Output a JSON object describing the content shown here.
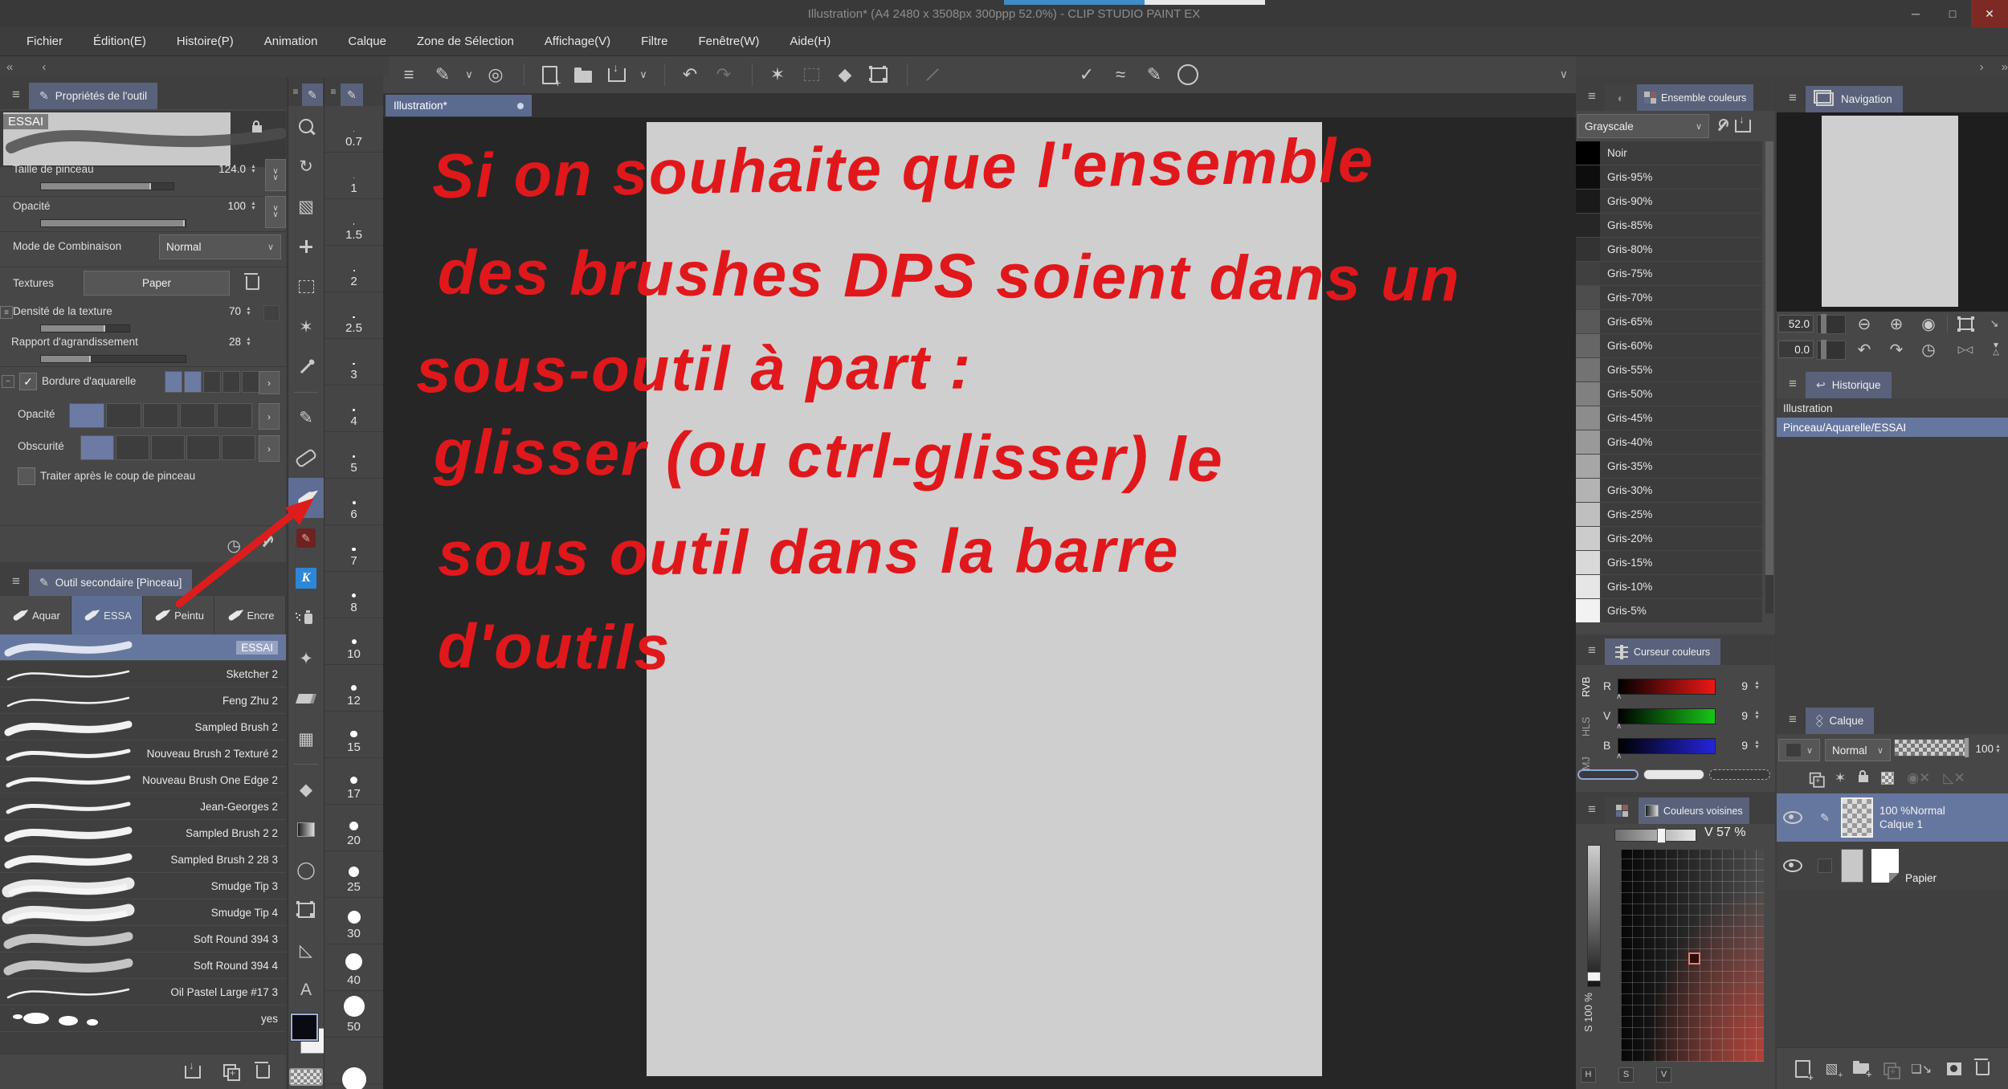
{
  "window": {
    "title": "Illustration* (A4 2480 x 3508px 300ppp 52.0%)  - CLIP STUDIO PAINT EX",
    "minimize": "─",
    "maximize": "□",
    "close": "✕"
  },
  "menu": {
    "items": [
      "Fichier",
      "Édition(E)",
      "Histoire(P)",
      "Animation",
      "Calque",
      "Zone de Sélection",
      "Affichage(V)",
      "Filtre",
      "Fenêtre(W)",
      "Aide(H)"
    ]
  },
  "command_bar": {
    "icons": [
      {
        "name": "main-menu-icon",
        "glyph": "≡"
      },
      {
        "name": "tool-switch-icon",
        "glyph": "✎"
      },
      {
        "name": "tool-switch-chevron-icon",
        "glyph": "∨",
        "small": true
      },
      {
        "name": "clip-studio-logo-icon",
        "glyph": "◎"
      },
      {
        "type": "divider"
      },
      {
        "name": "new-file-icon",
        "cls": "pageplus"
      },
      {
        "name": "open-file-icon",
        "cls": "folder"
      },
      {
        "name": "save-file-icon",
        "cls": "save"
      },
      {
        "name": "save-chevron-icon",
        "glyph": "∨",
        "small": true
      },
      {
        "type": "divider"
      },
      {
        "name": "undo-icon",
        "glyph": "↶"
      },
      {
        "name": "redo-icon",
        "glyph": "↷",
        "enabled": false
      },
      {
        "type": "divider"
      },
      {
        "name": "deselect-icon",
        "glyph": "✶"
      },
      {
        "name": "reselect-icon",
        "cls": "dashedrect",
        "enabled": false
      },
      {
        "name": "fill-selection-icon",
        "glyph": "◆"
      },
      {
        "name": "transform-icon",
        "cls": "framebox"
      },
      {
        "type": "divider"
      },
      {
        "name": "straight-line-icon",
        "cls": "slash",
        "enabled": false
      },
      {
        "type": "spacer"
      },
      {
        "name": "snap-ruler-icon",
        "glyph": "✓"
      },
      {
        "name": "snap-curve-icon",
        "glyph": "≈"
      },
      {
        "name": "snap-pen-icon",
        "glyph": "✎"
      },
      {
        "name": "help-icon",
        "cls": "help"
      }
    ],
    "collapse_glyph": "∨"
  },
  "document_tab": {
    "label": "Illustration*"
  },
  "tool_properties": {
    "panel_title": "Propriétés de l'outil",
    "brush_name": "ESSAI",
    "size_label": "Taille de pinceau",
    "size_value": "124.0",
    "opacity_label": "Opacité",
    "opacity_value": "100",
    "blend_label": "Mode de Combinaison",
    "blend_value": "Normal",
    "texture_label": "Textures",
    "texture_value": "Paper",
    "density_label": "Densité de la texture",
    "density_value": "70",
    "magnification_label": "Rapport d'agrandissement",
    "magnification_value": "28",
    "watercolor_label": "Bordure d'aquarelle",
    "wc_opacity_label": "Opacité",
    "darkness_label": "Obscurité",
    "post_process_label": "Traiter après le coup de pinceau",
    "check_glyph": "✓"
  },
  "subtool": {
    "panel_title": "Outil secondaire [Pinceau]",
    "tabs": [
      {
        "label": "Aquar",
        "selected": false
      },
      {
        "label": "ESSA",
        "selected": true
      },
      {
        "label": "Peintu",
        "selected": false
      },
      {
        "label": "Encre",
        "selected": false
      }
    ],
    "brushes": [
      {
        "name": "ESSAI",
        "stroke": "textured",
        "selected": true
      },
      {
        "name": "Sketcher 2",
        "stroke": "thin"
      },
      {
        "name": "Feng Zhu 2",
        "stroke": "thin"
      },
      {
        "name": "Sampled Brush 2",
        "stroke": "thick"
      },
      {
        "name": "Nouveau Brush 2 Texturé 2",
        "stroke": "medium"
      },
      {
        "name": "Nouveau Brush One Edge 2",
        "stroke": "medium"
      },
      {
        "name": "Jean-Georges 2",
        "stroke": "medium"
      },
      {
        "name": "Sampled Brush 2 2",
        "stroke": "thick"
      },
      {
        "name": "Sampled Brush 2 28 3",
        "stroke": "thick"
      },
      {
        "name": "Smudge Tip 3",
        "stroke": "fuzzy"
      },
      {
        "name": "Smudge Tip 4",
        "stroke": "fuzzy"
      },
      {
        "name": "Soft Round 394 3",
        "stroke": "soft"
      },
      {
        "name": "Soft Round 394 4",
        "stroke": "soft"
      },
      {
        "name": "Oil Pastel Large #17 3",
        "stroke": "thin"
      },
      {
        "name": "yes",
        "stroke": "blob"
      }
    ]
  },
  "toolbar": {
    "tools": [
      {
        "name": "zoom-tool-icon",
        "cls": "magnifier"
      },
      {
        "name": "rotate-canvas-icon",
        "glyph": "↻"
      },
      {
        "name": "object-tool-icon",
        "glyph": "▧"
      },
      {
        "name": "move-tool-icon",
        "cls": "movecross"
      },
      {
        "name": "selection-tool-icon",
        "cls": "dashedrect"
      },
      {
        "name": "magic-wand-icon",
        "glyph": "✶"
      },
      {
        "name": "eyedropper-icon",
        "cls": "pipette"
      },
      {
        "type": "divider"
      },
      {
        "name": "marker-tool-icon",
        "glyph": "✎"
      },
      {
        "name": "pencil-tool-icon",
        "cls": "pillline"
      },
      {
        "name": "brush-tool-icon",
        "cls": "brushshape",
        "selected": true
      },
      {
        "name": "decoration-tool-icon",
        "cls": "redstamp",
        "glyph": "✎"
      },
      {
        "name": "custom-k-tool-icon",
        "cls": "ktool",
        "glyph": "K"
      },
      {
        "name": "airbrush-tool-icon",
        "cls": "spray"
      },
      {
        "name": "sparkle-tool-icon",
        "glyph": "✦"
      },
      {
        "name": "eraser-tool-icon",
        "cls": "eraser"
      },
      {
        "name": "liquify-tool-icon",
        "glyph": "▦"
      },
      {
        "type": "divider"
      },
      {
        "name": "fill-tool-icon",
        "glyph": "◆"
      },
      {
        "name": "gradient-tool-icon",
        "cls": "gradientsq"
      },
      {
        "name": "figure-tool-icon",
        "glyph": "◯"
      },
      {
        "name": "frame-tool-icon",
        "cls": "framebox"
      },
      {
        "name": "polyline-tool-icon",
        "glyph": "◺"
      },
      {
        "name": "text-tool-icon",
        "glyph": "A"
      }
    ]
  },
  "brush_sizes": {
    "values": [
      "0.7",
      "1",
      "1.5",
      "2",
      "2.5",
      "3",
      "4",
      "5",
      "6",
      "7",
      "8",
      "10",
      "12",
      "15",
      "17",
      "20",
      "25",
      "30",
      "40",
      "50"
    ]
  },
  "canvas": {
    "ink_color": "#e0181b",
    "lines": [
      "Si on souhaite que l'ensemble",
      "des brushes DPS  soient dans un",
      "sous-outil  à part :",
      "glisser (ou ctrl-glisser)  le",
      "sous outil  dans la barre",
      "d'outils"
    ]
  },
  "color_set": {
    "panel_title": "Ensemble couleurs",
    "preset": "Grayscale",
    "colors": [
      {
        "name": "Noir",
        "hex": "#000000"
      },
      {
        "name": "Gris-95%",
        "hex": "#0d0d0d"
      },
      {
        "name": "Gris-90%",
        "hex": "#1a1a1a"
      },
      {
        "name": "Gris-85%",
        "hex": "#262626"
      },
      {
        "name": "Gris-80%",
        "hex": "#333333"
      },
      {
        "name": "Gris-75%",
        "hex": "#404040"
      },
      {
        "name": "Gris-70%",
        "hex": "#4d4d4d"
      },
      {
        "name": "Gris-65%",
        "hex": "#595959"
      },
      {
        "name": "Gris-60%",
        "hex": "#666666"
      },
      {
        "name": "Gris-55%",
        "hex": "#737373"
      },
      {
        "name": "Gris-50%",
        "hex": "#808080"
      },
      {
        "name": "Gris-45%",
        "hex": "#8c8c8c"
      },
      {
        "name": "Gris-40%",
        "hex": "#999999"
      },
      {
        "name": "Gris-35%",
        "hex": "#a6a6a6"
      },
      {
        "name": "Gris-30%",
        "hex": "#b3b3b3"
      },
      {
        "name": "Gris-25%",
        "hex": "#bfbfbf"
      },
      {
        "name": "Gris-20%",
        "hex": "#cccccc"
      },
      {
        "name": "Gris-15%",
        "hex": "#d9d9d9"
      },
      {
        "name": "Gris-10%",
        "hex": "#e6e6e6"
      },
      {
        "name": "Gris-5%",
        "hex": "#f2f2f2"
      }
    ]
  },
  "navigation": {
    "panel_title": "Navigation",
    "zoom": "52.0",
    "rotation": "0.0"
  },
  "history": {
    "panel_title": "Historique",
    "items": [
      {
        "label": "Illustration",
        "selected": false
      },
      {
        "label": "Pinceau/Aquarelle/ESSAI",
        "selected": true
      }
    ]
  },
  "color_slider": {
    "panel_title": "Curseur couleurs",
    "modes": [
      "RVB",
      "HLS",
      "CMJ"
    ],
    "active_mode": "RVB",
    "sliders": [
      {
        "label": "R",
        "value": "9"
      },
      {
        "label": "V",
        "value": "9"
      },
      {
        "label": "B",
        "value": "9"
      }
    ]
  },
  "neighbor_colors": {
    "panel_title": "Couleurs voisines",
    "v_label": "V 57 %",
    "s_label": "S 100 %",
    "axis_buttons": [
      "H",
      "S",
      "V"
    ]
  },
  "layers": {
    "panel_title": "Calque",
    "blend_mode": "Normal",
    "opacity": "100",
    "rows": [
      {
        "info": "100 %Normal",
        "name": "Calque 1",
        "selected": true
      },
      {
        "info": "",
        "name": "Papier",
        "selected": false
      }
    ]
  },
  "chrome": {
    "collapse_left": "«",
    "collapse_left2": "‹",
    "collapse_right": "›",
    "collapse_right2": "»",
    "selection_blue": "#66779f",
    "tab_blue": "#5d6d94"
  }
}
